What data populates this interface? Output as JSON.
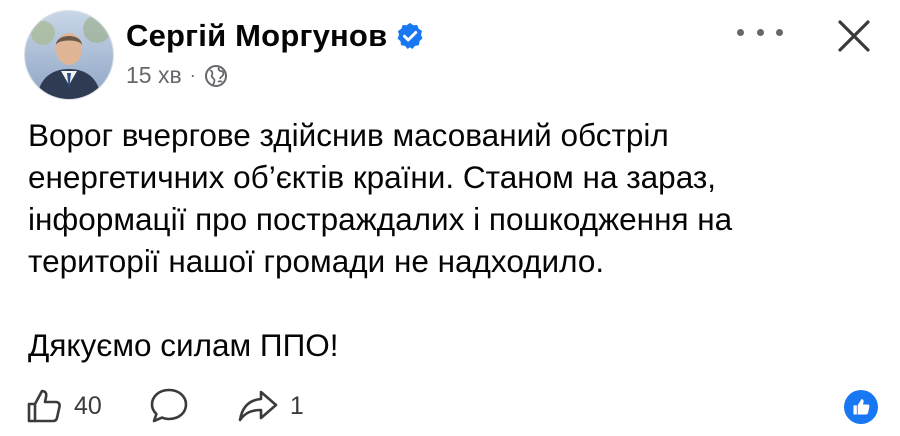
{
  "post": {
    "author": {
      "name": "Сергій Моргунов",
      "verified": true
    },
    "meta": {
      "time": "15 хв",
      "separator": "·",
      "audience_icon": "globe-icon"
    },
    "body": {
      "paragraph_1": "Ворог вчергове здійснив масований обстріл енергетичних об’єктів країни. Станом на зараз, інформації про постраждалих і пошкодження на території нашої громади не надходило.",
      "paragraph_2": "Дякуємо силам ППО!"
    },
    "actions": {
      "like_count": "40",
      "share_count": "1"
    },
    "icons": {
      "like": "thumbs-up-icon",
      "comment": "comment-bubble-icon",
      "share": "share-arrow-icon",
      "more": "more-dots-icon",
      "close": "close-icon",
      "reaction": "like-reaction-icon"
    },
    "colors": {
      "brand_blue": "#1877f2",
      "secondary_text": "#65676b",
      "primary_text": "#050505"
    }
  }
}
